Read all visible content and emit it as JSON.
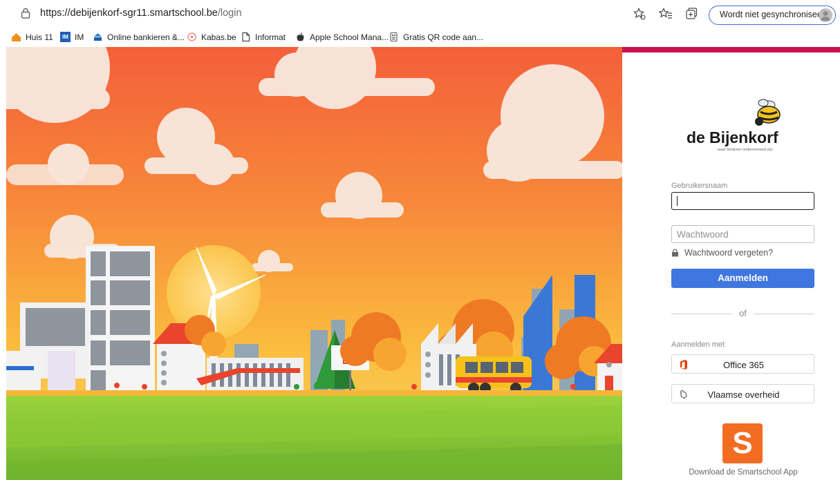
{
  "browser": {
    "url_host": "https://debijenkorf-sgr11.smartschool.be",
    "url_path": "/login",
    "sync_label": "Wordt niet gesynchroniseerd"
  },
  "bookmarks": [
    {
      "label": "Huis 11",
      "icon": "home-icon"
    },
    {
      "label": "IM",
      "icon": "im-icon"
    },
    {
      "label": "Online bankieren &...",
      "icon": "kbc-icon"
    },
    {
      "label": "Kabas.be",
      "icon": "kabas-icon"
    },
    {
      "label": "Informat",
      "icon": "page-icon"
    },
    {
      "label": "Apple School Mana...",
      "icon": "apple-icon"
    },
    {
      "label": "Gratis QR code aan...",
      "icon": "qr-icon"
    }
  ],
  "logo": {
    "name_part1": "de",
    "name_part2": "Bijenkorf",
    "tagline": "waar kinderen ondernemend zijn"
  },
  "login": {
    "username_label": "Gebruikersnaam",
    "username_value": "",
    "password_placeholder": "Wachtwoord",
    "forgot_label": "Wachtwoord vergeten?",
    "submit_label": "Aanmelden",
    "or_label": "of",
    "sso_label": "Aanmelden met",
    "sso_office": "Office 365",
    "sso_vlaamse": "Vlaamse overheid",
    "app_icon_letter": "S",
    "app_label": "Download de Smartschool App"
  },
  "colors": {
    "accent": "#c8124f",
    "button": "#3f76df",
    "app": "#f26d21"
  }
}
